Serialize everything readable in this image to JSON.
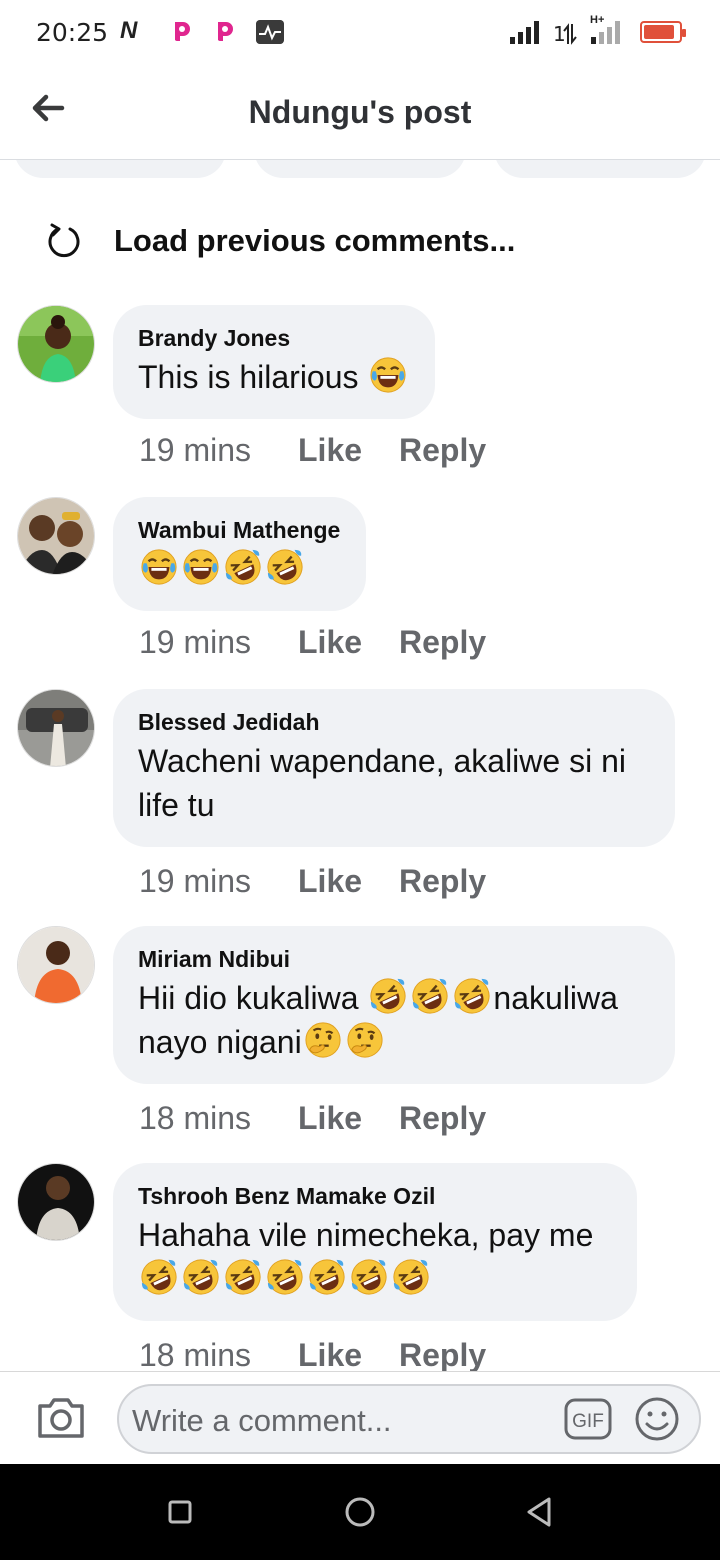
{
  "status_bar": {
    "time": "20:25",
    "n_icon": "N",
    "icons": [
      "n-icon",
      "p-app-icon",
      "p-app-icon",
      "pulse-icon",
      "signal-icon",
      "data-arrows-icon",
      "signal-h-plus-icon",
      "battery-low-icon"
    ],
    "network_label": "H+",
    "data_label": "1",
    "colors": {
      "battery": "#e0503a",
      "p_app": "#e0268f"
    }
  },
  "header": {
    "title": "Ndungu's post",
    "back_icon": "arrow-left-icon"
  },
  "load_previous": {
    "label": "Load previous comments...",
    "icon": "refresh-icon"
  },
  "comments": [
    {
      "name": "Brandy Jones",
      "text": "This is hilarious ",
      "emojis": [
        "tears-of-joy"
      ],
      "time": "19 mins",
      "like": "Like",
      "reply": "Reply"
    },
    {
      "name": "Wambui Mathenge",
      "text": "",
      "emojis": [
        "tears-of-joy",
        "tears-of-joy",
        "rolling-laughing",
        "rolling-laughing"
      ],
      "time": "19 mins",
      "like": "Like",
      "reply": "Reply"
    },
    {
      "name": "Blessed Jedidah",
      "text_line1": "Wacheni wapendane, akaliwe si ni",
      "text_line2": "life tu",
      "time": "19 mins",
      "like": "Like",
      "reply": "Reply"
    },
    {
      "name": "Miriam Ndibui",
      "text_part1": "Hii dio kukaliwa ",
      "text_part2": "nakuliwa",
      "text_part3": "nayo nigani",
      "emojis_a": [
        "rolling-laughing",
        "rolling-laughing",
        "rolling-laughing"
      ],
      "emojis_b": [
        "thinking",
        "thinking"
      ],
      "time": "18 mins",
      "like": "Like",
      "reply": "Reply"
    },
    {
      "name": "Tshrooh Benz Mamake Ozil",
      "text": "Hahaha vile nimecheka, pay me",
      "emojis": [
        "rolling-laughing",
        "rolling-laughing",
        "rolling-laughing",
        "rolling-laughing",
        "rolling-laughing",
        "rolling-laughing",
        "rolling-laughing"
      ],
      "time": "18 mins",
      "like": "Like",
      "reply": "Reply"
    }
  ],
  "composer": {
    "placeholder": "Write a comment...",
    "gif_label": "GIF",
    "camera_icon": "camera-icon",
    "emoji_icon": "smiley-icon"
  },
  "nav_bar": {
    "icons": [
      "square-recents-icon",
      "circle-home-icon",
      "triangle-back-icon"
    ]
  }
}
